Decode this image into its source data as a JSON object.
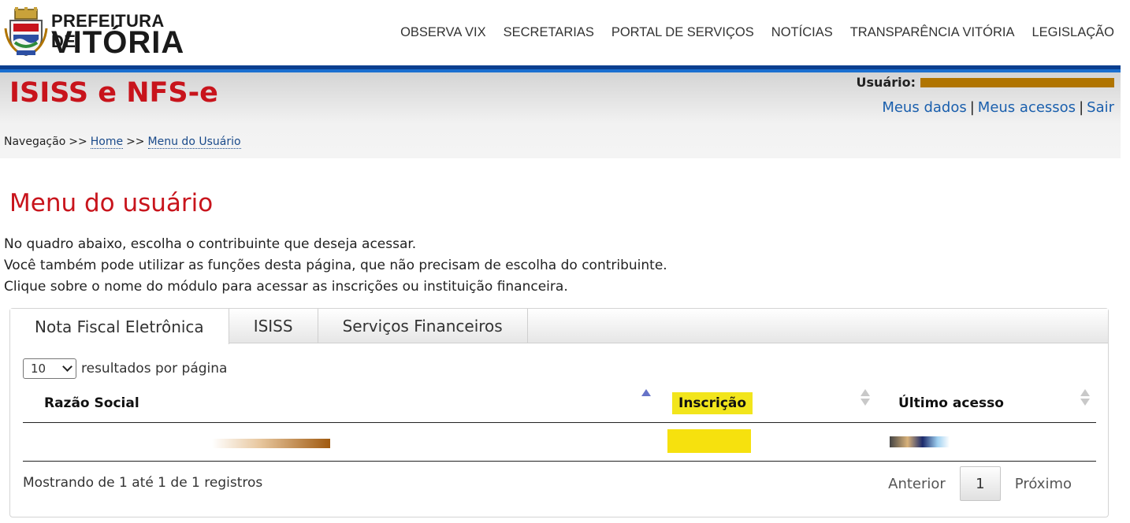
{
  "brand": {
    "line1": "PREFEITURA DE",
    "line2": "VITÓRIA"
  },
  "top_nav": [
    "OBSERVA VIX",
    "SECRETARIAS",
    "PORTAL DE SERVIÇOS",
    "NOTÍCIAS",
    "TRANSPARÊNCIA VITÓRIA",
    "LEGISLAÇÃO"
  ],
  "header": {
    "app_title": "ISISS e NFS-e",
    "user_label": "Usuário:",
    "user_links": [
      "Meus dados",
      "Meus acessos",
      "Sair"
    ],
    "user_links_sep": "|"
  },
  "breadcrumb": {
    "label": "Navegação",
    "sep": ">>",
    "items": [
      "Home",
      "Menu do Usuário"
    ]
  },
  "main": {
    "title": "Menu do usuário",
    "intro": [
      "No quadro abaixo, escolha o contribuinte que deseja acessar.",
      "Você também pode utilizar as funções desta página, que não precisam de escolha do contribuinte.",
      "Clique sobre o nome do módulo para acessar as inscrições ou instituição financeira."
    ]
  },
  "tabs": [
    {
      "label": "Nota Fiscal Eletrônica",
      "active": true
    },
    {
      "label": "ISISS",
      "active": false
    },
    {
      "label": "Serviços Financeiros",
      "active": false
    }
  ],
  "table": {
    "page_length": "10",
    "page_length_label": "resultados por página",
    "columns": [
      "Razão Social",
      "Inscrição",
      "Último acesso"
    ],
    "sort": {
      "column": "Razão Social",
      "direction": "asc"
    },
    "info": "Mostrando de 1 até 1 de 1 registros",
    "pagination": {
      "prev": "Anterior",
      "current": "1",
      "next": "Próximo"
    }
  },
  "colors": {
    "brand_red": "#c8141c",
    "nav_blue": "#0b3f8f",
    "link": "#1a5fad",
    "highlight": "#f2e51c"
  },
  "icons": [
    "city-crest-icon",
    "chevron-down-icon",
    "sort-asc-icon",
    "sort-both-icon"
  ]
}
